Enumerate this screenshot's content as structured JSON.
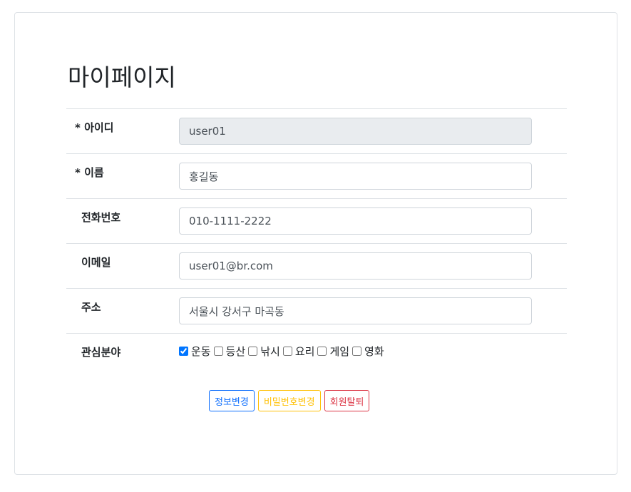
{
  "page": {
    "title": "마이페이지"
  },
  "form": {
    "id": {
      "label": "* 아이디",
      "value": "user01"
    },
    "name": {
      "label": "* 이름",
      "value": "홍길동"
    },
    "phone": {
      "label": "전화번호",
      "value": "010-1111-2222"
    },
    "email": {
      "label": "이메일",
      "value": "user01@br.com"
    },
    "address": {
      "label": "주소",
      "value": "서울시 강서구 마곡동"
    },
    "interests": {
      "label": "관심분야",
      "options": [
        {
          "label": "운동",
          "checked": true
        },
        {
          "label": "등산",
          "checked": false
        },
        {
          "label": "낚시",
          "checked": false
        },
        {
          "label": "요리",
          "checked": false
        },
        {
          "label": "게임",
          "checked": false
        },
        {
          "label": "영화",
          "checked": false
        }
      ]
    }
  },
  "buttons": {
    "update_info": "정보변경",
    "change_password": "비밀번호변경",
    "withdraw": "회원탈퇴"
  },
  "colors": {
    "primary": "#0d6efd",
    "warning": "#ffc107",
    "danger": "#dc3545"
  }
}
